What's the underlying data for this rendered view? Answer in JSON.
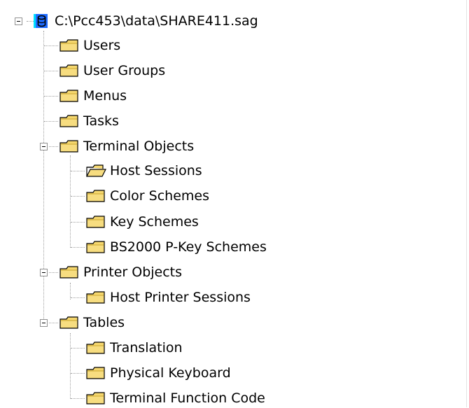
{
  "tree": {
    "root": {
      "label": "C:\\Pcc453\\data\\SHARE411.sag",
      "icon": "database-icon"
    },
    "items": [
      {
        "label": "Users",
        "icon": "folder-icon"
      },
      {
        "label": "User Groups",
        "icon": "folder-icon"
      },
      {
        "label": "Menus",
        "icon": "folder-icon"
      },
      {
        "label": "Tasks",
        "icon": "folder-icon"
      },
      {
        "label": "Terminal Objects",
        "icon": "folder-icon",
        "expanded": true,
        "children": [
          {
            "label": "Host Sessions",
            "icon": "folder-open-icon"
          },
          {
            "label": "Color Schemes",
            "icon": "folder-icon"
          },
          {
            "label": "Key Schemes",
            "icon": "folder-icon"
          },
          {
            "label": "BS2000 P-Key Schemes",
            "icon": "folder-icon"
          }
        ]
      },
      {
        "label": "Printer Objects",
        "icon": "folder-icon",
        "expanded": true,
        "children": [
          {
            "label": "Host Printer Sessions",
            "icon": "folder-icon"
          }
        ]
      },
      {
        "label": "Tables",
        "icon": "folder-icon",
        "expanded": true,
        "children": [
          {
            "label": "Translation",
            "icon": "folder-icon"
          },
          {
            "label": "Physical Keyboard",
            "icon": "folder-icon"
          },
          {
            "label": "Terminal Function Code",
            "icon": "folder-icon"
          }
        ]
      }
    ]
  },
  "colors": {
    "folder": "#f5d76e",
    "folder_dark": "#c9a52c",
    "db_blue": "#1e6bff",
    "db_cyan": "#00e0ff"
  }
}
